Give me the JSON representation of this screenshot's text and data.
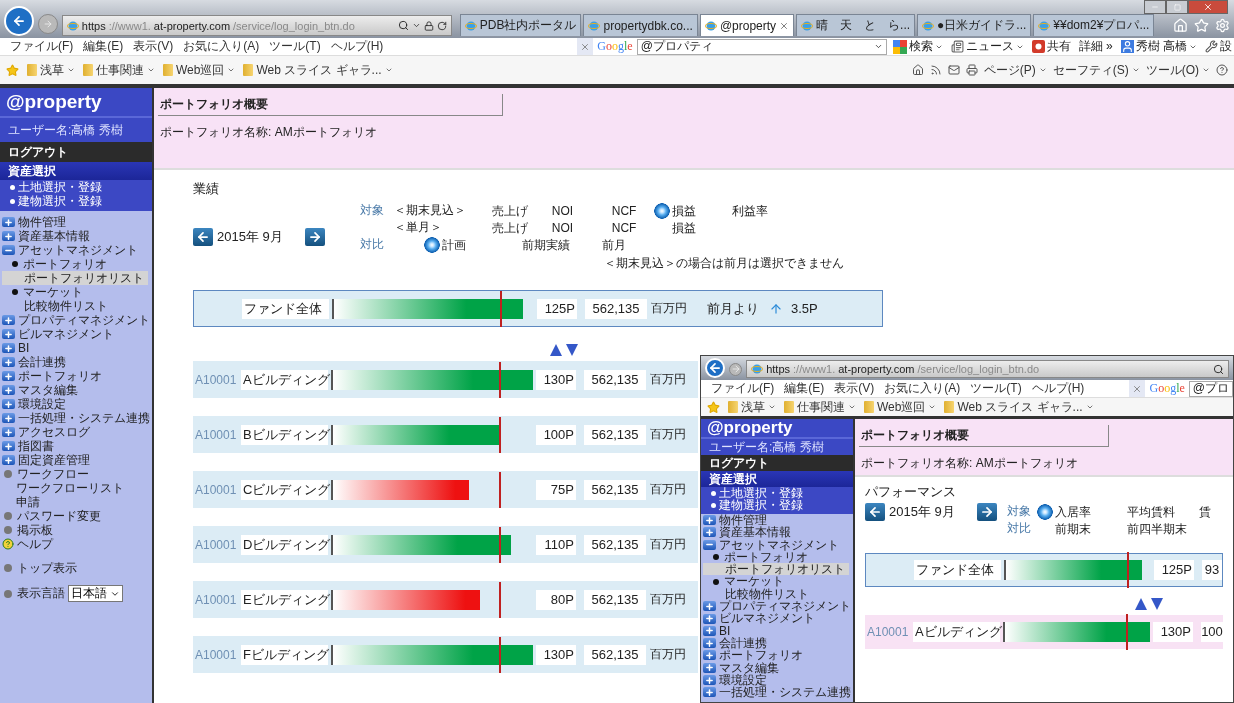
{
  "browser": {
    "url": [
      {
        "text": "https",
        "strong": true
      },
      {
        "text": "://www1.",
        "strong": false
      },
      {
        "text": "at-property.com",
        "strong": true
      },
      {
        "text": "/service/log_login_btn.do",
        "strong": false
      }
    ],
    "tabs": [
      {
        "label": "PDB社内ポータル",
        "selected": false
      },
      {
        "label": "propertydbk.co...",
        "selected": false
      },
      {
        "label": "@property",
        "selected": true
      },
      {
        "label": "晴　天　と　ら...",
        "selected": false
      },
      {
        "label": "●日米ガイドラ...",
        "selected": false
      },
      {
        "label": "¥¥dom2¥プロパ...",
        "selected": false
      }
    ],
    "menu": [
      "ファイル(F)",
      "編集(E)",
      "表示(V)",
      "お気に入り(A)",
      "ツール(T)",
      "ヘルプ(H)"
    ],
    "search": {
      "engine": "Google",
      "value": "@プロパティ"
    },
    "tools": [
      {
        "kind": "search",
        "label": "検索",
        "dropdown": true
      },
      {
        "kind": "news",
        "label": "ニュース",
        "dropdown": true
      },
      {
        "kind": "share",
        "label": "共有",
        "dropdown": false
      },
      {
        "kind": "more",
        "label": "詳細 »",
        "dropdown": false
      },
      {
        "kind": "user",
        "label": "秀樹 高橋",
        "dropdown": true
      },
      {
        "kind": "settings",
        "label": "設",
        "dropdown": false
      }
    ],
    "favorites": [
      "浅草",
      "仕事関連",
      "Web巡回",
      "Web スライス ギャラ..."
    ],
    "commands": [
      "ページ(P)",
      "セーフティ(S)",
      "ツール(O)"
    ]
  },
  "sidebar": {
    "logo": "@property",
    "user": "ユーザー名:高橋 秀樹",
    "logout": "ログアウト",
    "asset_select": {
      "title": "資産選択",
      "links": [
        "土地選択・登録",
        "建物選択・登録"
      ]
    },
    "items": [
      {
        "kind": "folder",
        "label": "物件管理",
        "expanded": false
      },
      {
        "kind": "folder",
        "label": "資産基本情報",
        "expanded": false
      },
      {
        "kind": "folder",
        "label": "アセットマネジメント",
        "expanded": true,
        "children": [
          {
            "kind": "bullet",
            "label": "ポートフォリオ",
            "children": [
              {
                "kind": "link",
                "label": "ポートフォリオリスト",
                "selected": true
              }
            ]
          },
          {
            "kind": "bullet",
            "label": "マーケット",
            "children": [
              {
                "kind": "link",
                "label": "比較物件リスト",
                "selected": false
              }
            ]
          }
        ]
      },
      {
        "kind": "folder",
        "label": "プロパティマネジメント",
        "expanded": false
      },
      {
        "kind": "folder",
        "label": "ビルマネジメント",
        "expanded": false
      },
      {
        "kind": "folder",
        "label": "BI",
        "expanded": false
      },
      {
        "kind": "folder",
        "label": "会計連携",
        "expanded": false
      },
      {
        "kind": "folder",
        "label": "ポートフォリオ",
        "expanded": false
      },
      {
        "kind": "folder",
        "label": "マスタ編集",
        "expanded": false
      },
      {
        "kind": "folder",
        "label": "環境設定",
        "expanded": false
      },
      {
        "kind": "folder",
        "label": "一括処理・システム連携",
        "expanded": false
      },
      {
        "kind": "folder",
        "label": "アクセスログ",
        "expanded": false
      },
      {
        "kind": "folder",
        "label": "指図書",
        "expanded": false
      },
      {
        "kind": "folder",
        "label": "固定資産管理",
        "expanded": false
      },
      {
        "kind": "dot",
        "label": "ワークフロー",
        "children": [
          {
            "kind": "link",
            "label": "ワークフローリスト",
            "selected": false
          },
          {
            "kind": "link",
            "label": "申請",
            "selected": false
          }
        ]
      },
      {
        "kind": "dot",
        "label": "パスワード変更"
      },
      {
        "kind": "dot",
        "label": "掲示板"
      },
      {
        "kind": "help",
        "label": "ヘルプ"
      }
    ],
    "footer": [
      {
        "kind": "dot",
        "label": "トップ表示"
      }
    ],
    "language": {
      "label": "表示言語",
      "value": "日本語"
    }
  },
  "header": {
    "title": "ポートフォリオ概要",
    "portfolio_label": "ポートフォリオ名称:",
    "portfolio_name": "AMポートフォリオ"
  },
  "section": {
    "title": "業績",
    "period": "2015年 9月",
    "target": {
      "label": "対象",
      "rows": [
        {
          "label": "＜期末見込＞",
          "options": [
            {
              "label": "売上げ",
              "selected": false
            },
            {
              "label": "NOI",
              "selected": false
            },
            {
              "label": "NCF",
              "selected": false
            },
            {
              "label": "損益",
              "selected": true
            },
            {
              "label": "利益率",
              "selected": false
            }
          ]
        },
        {
          "label": "＜単月＞",
          "options": [
            {
              "label": "売上げ",
              "selected": false
            },
            {
              "label": "NOI",
              "selected": false
            },
            {
              "label": "NCF",
              "selected": false
            },
            {
              "label": "損益",
              "selected": false
            }
          ]
        }
      ]
    },
    "compare": {
      "label": "対比",
      "options": [
        {
          "label": "計画",
          "selected": true
        },
        {
          "label": "前期実績",
          "selected": false
        },
        {
          "label": "前月",
          "selected": false
        }
      ]
    },
    "note": "＜期末見込＞の場合は前月は選択できません"
  },
  "fund": {
    "label": "ファンド全体",
    "level": 0.93,
    "below_plan": false,
    "value": "125P",
    "amount": "562,135",
    "unit": "百万円",
    "change_label": "前月より",
    "change": "3.5P"
  },
  "rows": [
    {
      "code": "A10001",
      "name": "Aビルディング",
      "level": 0.987,
      "below_plan": false,
      "value": "130P",
      "amount": "562,135",
      "unit": "百万円"
    },
    {
      "code": "A10001",
      "name": "Bビルディング",
      "level": 0.818,
      "below_plan": false,
      "value": "100P",
      "amount": "562,135",
      "unit": "百万円"
    },
    {
      "code": "A10001",
      "name": "Cビルディング",
      "level": 0.671,
      "below_plan": true,
      "value": "75P",
      "amount": "562,135",
      "unit": "百万円"
    },
    {
      "code": "A10001",
      "name": "Dビルディング",
      "level": 0.876,
      "below_plan": false,
      "value": "110P",
      "amount": "562,135",
      "unit": "百万円"
    },
    {
      "code": "A10001",
      "name": "Eビルディング",
      "level": 0.724,
      "below_plan": true,
      "value": "80P",
      "amount": "562,135",
      "unit": "百万円"
    },
    {
      "code": "A10001",
      "name": "Fビルディング",
      "level": 0.987,
      "below_plan": false,
      "value": "130P",
      "amount": "562,135",
      "unit": "百万円"
    }
  ],
  "inset_window": {
    "browser": {
      "url": [
        {
          "text": "https",
          "strong": true
        },
        {
          "text": "://www1.",
          "strong": false
        },
        {
          "text": "at-property.com",
          "strong": true
        },
        {
          "text": "/service/log_login_btn.do",
          "strong": false
        }
      ],
      "menu": [
        "ファイル(F)",
        "編集(E)",
        "表示(V)",
        "お気に入り(A)",
        "ツール(T)",
        "ヘルプ(H)"
      ],
      "search": {
        "engine": "Google",
        "value": "@プロ"
      },
      "favorites": [
        "浅草",
        "仕事関連",
        "Web巡回",
        "Web スライス ギャラ..."
      ]
    },
    "sidebar": {
      "logo": "@property",
      "user": "ユーザー名:高橋 秀樹",
      "logout": "ログアウト",
      "asset_select": {
        "title": "資産選択",
        "links": [
          "土地選択・登録",
          "建物選択・登録"
        ]
      },
      "items": [
        {
          "kind": "folder",
          "label": "物件管理",
          "expanded": false
        },
        {
          "kind": "folder",
          "label": "資産基本情報",
          "expanded": false
        },
        {
          "kind": "folder",
          "label": "アセットマネジメント",
          "expanded": true,
          "children": [
            {
              "kind": "bullet",
              "label": "ポートフォリオ",
              "children": [
                {
                  "kind": "link",
                  "label": "ポートフォリオリスト",
                  "selected": true
                }
              ]
            },
            {
              "kind": "bullet",
              "label": "マーケット",
              "children": [
                {
                  "kind": "link",
                  "label": "比較物件リスト",
                  "selected": false
                }
              ]
            }
          ]
        },
        {
          "kind": "folder",
          "label": "プロパティマネジメント",
          "expanded": false
        },
        {
          "kind": "folder",
          "label": "ビルマネジメント",
          "expanded": false
        },
        {
          "kind": "folder",
          "label": "BI",
          "expanded": false
        },
        {
          "kind": "folder",
          "label": "会計連携",
          "expanded": false
        },
        {
          "kind": "folder",
          "label": "ポートフォリオ",
          "expanded": false
        },
        {
          "kind": "folder",
          "label": "マスタ編集",
          "expanded": false
        },
        {
          "kind": "folder",
          "label": "環境設定",
          "expanded": false
        },
        {
          "kind": "folder",
          "label": "一括処理・システム連携",
          "expanded": false
        }
      ]
    },
    "header": {
      "title": "ポートフォリオ概要",
      "portfolio_label": "ポートフォリオ名称:",
      "portfolio_name": "AMポートフォリオ"
    },
    "section": {
      "title": "パフォーマンス",
      "period": "2015年 9月",
      "target": {
        "label": "対象",
        "rows": [
          {
            "options": [
              {
                "label": "入居率",
                "selected": true
              },
              {
                "label": "平均賃料",
                "selected": false
              },
              {
                "label": "賃",
                "selected": false
              }
            ]
          }
        ]
      },
      "compare": {
        "label": "対比",
        "options": [
          {
            "label": "前期末",
            "selected": false
          },
          {
            "label": "前四半期末",
            "selected": false
          }
        ]
      }
    },
    "fund": {
      "label": "ファンド全体",
      "level": 0.92,
      "below_plan": false,
      "value": "125P",
      "amount": "93"
    },
    "rows": [
      {
        "code": "A10001",
        "name": "Aビルディング",
        "level": 0.977,
        "below_plan": false,
        "value": "130P",
        "amount": "100"
      }
    ]
  }
}
